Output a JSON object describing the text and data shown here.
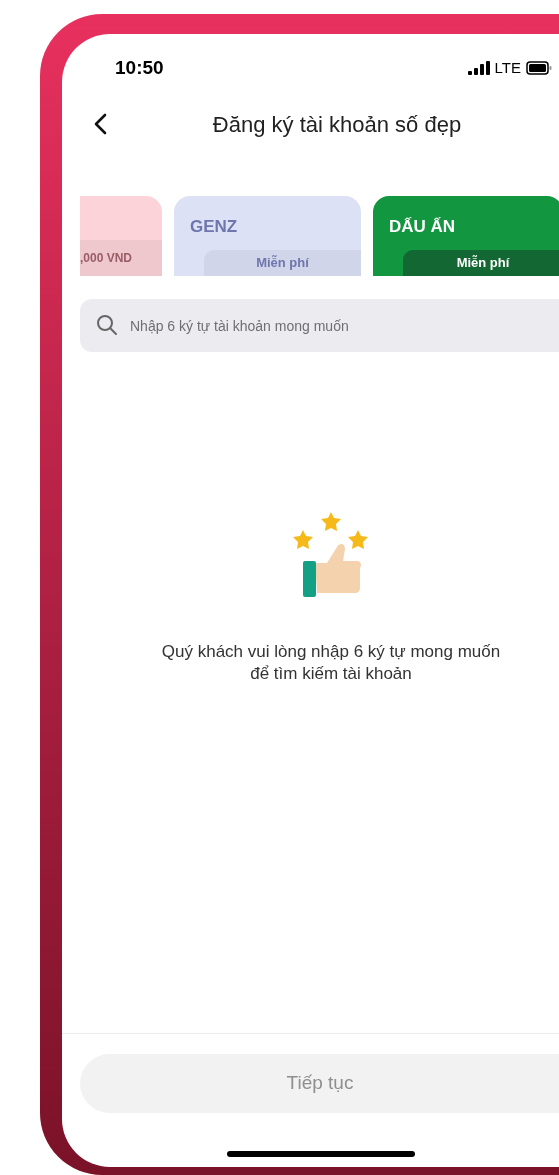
{
  "status_bar": {
    "time": "10:50",
    "network": "LTE"
  },
  "header": {
    "title": "Đăng ký tài khoản số đẹp"
  },
  "cards": [
    {
      "price": ",000 VND",
      "selected": false
    },
    {
      "title": "GENZ",
      "price": "Miễn phí",
      "selected": false
    },
    {
      "title": "DẤU ẤN",
      "price": "Miễn phí",
      "selected": true
    }
  ],
  "search": {
    "placeholder": "Nhập 6 ký tự tài khoản mong muốn"
  },
  "empty_state": {
    "message": "Quý khách vui lòng nhập 6 ký tự mong muốn để tìm kiếm tài khoản"
  },
  "continue_button": {
    "label": "Tiếp tục",
    "disabled": true
  }
}
